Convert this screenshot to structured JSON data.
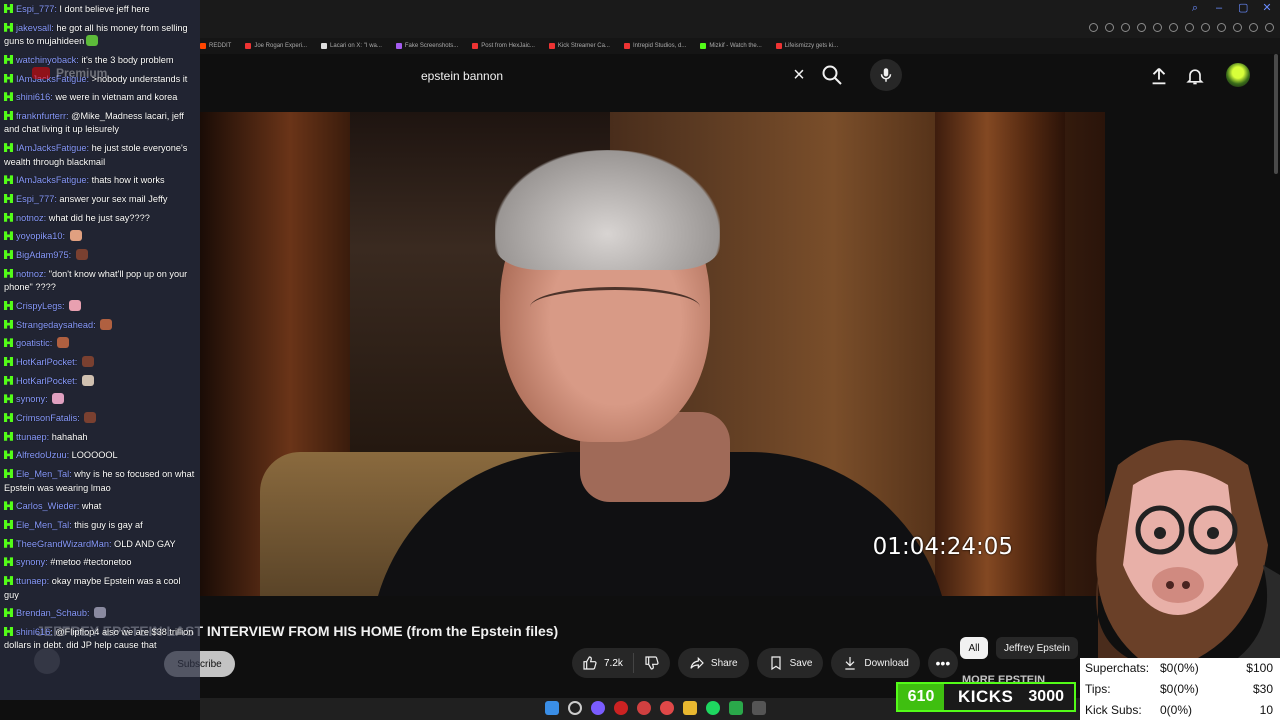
{
  "browser": {
    "bookmarks": [
      {
        "label": "REDDIT",
        "color": "#ff4500"
      },
      {
        "label": "Joe Rogan Experi...",
        "color": "#e33"
      },
      {
        "label": "Lacari on X: \"I wa...",
        "color": "#ddd"
      },
      {
        "label": "Fake Screenshots...",
        "color": "#a55cf0"
      },
      {
        "label": "Post from HexJaic...",
        "color": "#e33"
      },
      {
        "label": "Kick Streamer Ca...",
        "color": "#e33"
      },
      {
        "label": "Intrepid Studios, d...",
        "color": "#e33"
      },
      {
        "label": "Mizkif - Watch the...",
        "color": "#53fc18"
      },
      {
        "label": "Lifeismizzy gets ki...",
        "color": "#e33"
      }
    ]
  },
  "youtube": {
    "logo_text": "Premium",
    "search": {
      "value": "epstein bannon"
    },
    "video": {
      "timestamp": "01:04:24:05",
      "title": "JEFFREY EPSTEIN LAST INTERVIEW FROM HIS HOME (from the Epstein files)",
      "subscribe_label": "Subscribe",
      "likes": "7.2k",
      "share_label": "Share",
      "save_label": "Save",
      "download_label": "Download"
    },
    "chips": [
      "All",
      "Jeffrey Epstein"
    ]
  },
  "chat": [
    {
      "user": "Espi_777",
      "text": "I dont believe jeff here"
    },
    {
      "user": "jakevsall",
      "text": "he got all his money from selling guns to mujahideen",
      "emote": "#5dbb3a"
    },
    {
      "user": "watchinyoback",
      "text": "it's the 3 body problem"
    },
    {
      "user": "IAmJacksFatigue",
      "text": ">nobody understands it"
    },
    {
      "user": "shini616",
      "text": "we were in vietnam and korea"
    },
    {
      "user": "franknfurterr",
      "text": "@Mike_Madness lacari, jeff and chat living it up leisurely"
    },
    {
      "user": "IAmJacksFatigue",
      "text": "he just stole everyone's wealth through blackmail"
    },
    {
      "user": "IAmJacksFatigue",
      "text": "thats how it works"
    },
    {
      "user": "Espi_777",
      "text": "answer your sex mail Jeffy"
    },
    {
      "user": "notnoz",
      "text": "what did he just say????"
    },
    {
      "user": "yoyopika10",
      "text": "",
      "emote": "#e0a080"
    },
    {
      "user": "BigAdam975",
      "text": "",
      "emote": "#7a4030"
    },
    {
      "user": "notnoz",
      "text": "\"don't know what'll pop up on your phone\" ????"
    },
    {
      "user": "CrispyLegs",
      "text": "",
      "emote": "#e8a0b0"
    },
    {
      "user": "Strangedaysahead",
      "text": "",
      "emote": "#b06040"
    },
    {
      "user": "goatistic",
      "text": "",
      "emote": "#b06040"
    },
    {
      "user": "HotKarlPocket",
      "text": "",
      "emote": "#7a4030"
    },
    {
      "user": "HotKarlPocket",
      "text": "",
      "emote": "#d0c0b0"
    },
    {
      "user": "synony",
      "text": "",
      "emote": "#e0a0c0"
    },
    {
      "user": "CrimsonFatalis",
      "text": "",
      "emote": "#7a4030"
    },
    {
      "user": "ttunaep",
      "text": "hahahah"
    },
    {
      "user": "AlfredoUzuu",
      "text": "LOOOOOL"
    },
    {
      "user": "Ele_Men_Tal",
      "text": "why is he so focused on what Epstein was wearing lmao"
    },
    {
      "user": "Carlos_Wieder",
      "text": "what"
    },
    {
      "user": "Ele_Men_Tal",
      "text": "this guy is gay af"
    },
    {
      "user": "TheeGrandWizardMan",
      "text": "OLD AND GAY"
    },
    {
      "user": "synony",
      "text": "#metoo #tectonetoo"
    },
    {
      "user": "ttunaep",
      "text": "okay maybe Epstein was a cool guy"
    },
    {
      "user": "Brendan_Schaub",
      "text": "",
      "emote": "#8a8aa0"
    },
    {
      "user": "shini616",
      "text": "@Flipflop4 also we are $38 trillion dollars in debt. did JP help cause that"
    }
  ],
  "overlay": {
    "kicks_count": "610",
    "kicks_label": "KICKS",
    "kicks_goal": "3000",
    "kicks_progress_fraction": 0.2033,
    "more_text": "MORE EPSTEIN",
    "stats": [
      {
        "label": "Superchats:",
        "value": "$0(0%)",
        "goal": "$100"
      },
      {
        "label": "Tips:",
        "value": "$0(0%)",
        "goal": "$30"
      },
      {
        "label": "Kick Subs:",
        "value": "0(0%)",
        "goal": "10"
      }
    ]
  },
  "colors": {
    "kick_green": "#53fc18",
    "yt_bg": "#0f0f0f",
    "chat_user": "#8a9cff"
  }
}
